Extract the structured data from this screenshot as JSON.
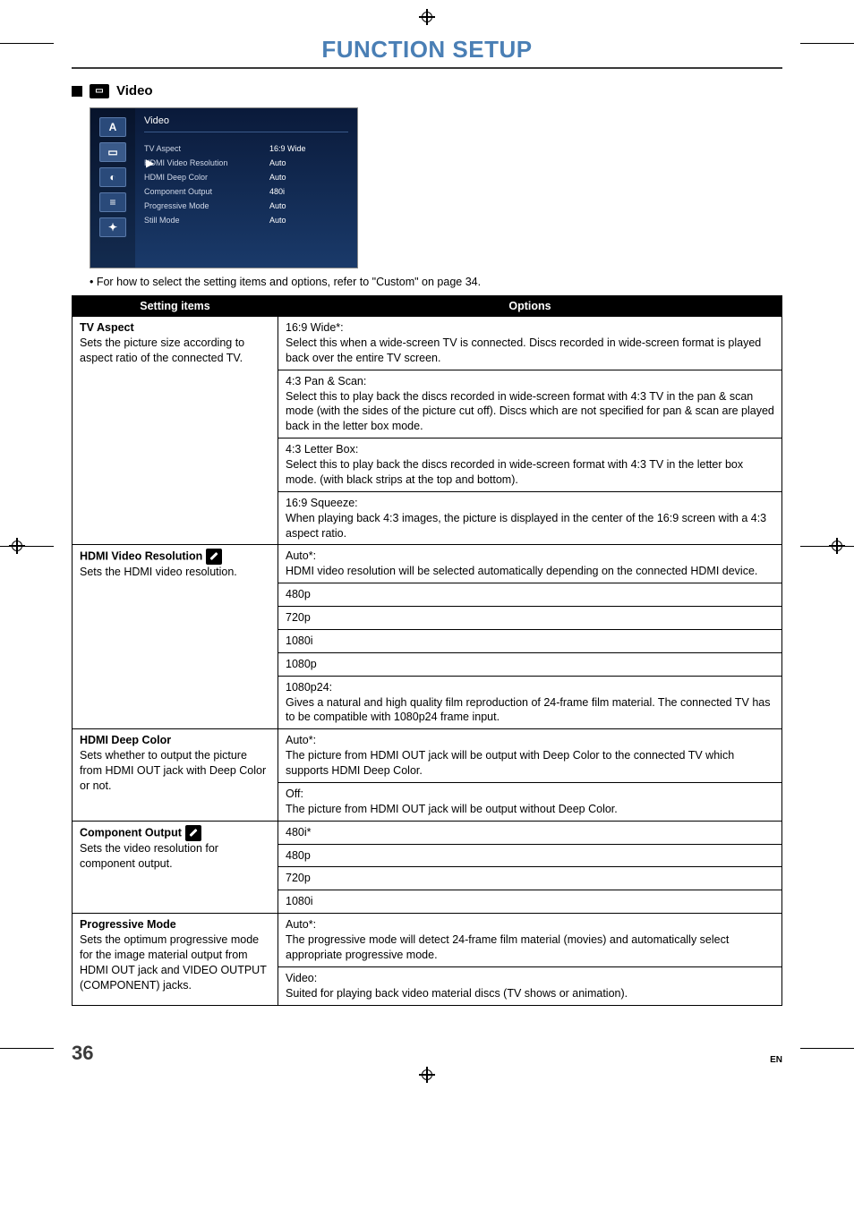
{
  "page_title": "FUNCTION SETUP",
  "section_label": "Video",
  "osd": {
    "title": "Video",
    "side_letter": "A",
    "rows": [
      {
        "k": "TV Aspect",
        "v": "16:9 Wide"
      },
      {
        "k": "HDMI Video Resolution",
        "v": "Auto"
      },
      {
        "k": "HDMI Deep Color",
        "v": "Auto"
      },
      {
        "k": "Component Output",
        "v": "480i"
      },
      {
        "k": "Progressive Mode",
        "v": "Auto"
      },
      {
        "k": "Still Mode",
        "v": "Auto"
      }
    ]
  },
  "note_bullet": "• For how to select the setting items and options, refer to \"Custom\" on page 34.",
  "headers": {
    "left": "Setting items",
    "right": "Options"
  },
  "items": [
    {
      "title": "TV Aspect",
      "desc": "Sets the picture size according to aspect ratio of the connected TV.",
      "tool": false,
      "options": [
        "16:9 Wide*:\nSelect this when a wide-screen TV is connected. Discs recorded in wide-screen format is played back over the entire TV screen.",
        "4:3 Pan & Scan:\nSelect this to play back the discs recorded in wide-screen format with 4:3 TV in the pan & scan mode (with the sides of the picture cut off). Discs which are not specified for pan & scan are played back in the letter box mode.",
        "4:3 Letter Box:\nSelect this to play back the discs recorded in wide-screen format with 4:3 TV in the letter box mode. (with black strips at the top and bottom).",
        "16:9 Squeeze:\nWhen playing back 4:3 images, the picture is displayed in the center of the 16:9 screen with a 4:3 aspect ratio."
      ]
    },
    {
      "title": "HDMI Video Resolution",
      "desc": "Sets the HDMI video resolution.",
      "tool": true,
      "options": [
        "Auto*:\nHDMI video resolution will be selected automatically depending on the connected HDMI device.",
        "480p",
        "720p",
        "1080i",
        "1080p",
        "1080p24:\nGives a natural and high quality film reproduction of 24-frame film material. The connected TV has to be compatible with 1080p24 frame input."
      ]
    },
    {
      "title": "HDMI Deep Color",
      "desc": "Sets whether to output the picture from HDMI OUT jack with Deep Color or not.",
      "tool": false,
      "options": [
        "Auto*:\nThe picture from HDMI OUT jack will be output with Deep Color to the connected TV which supports HDMI Deep Color.",
        "Off:\nThe picture from HDMI OUT jack will be output without Deep Color."
      ]
    },
    {
      "title": "Component Output",
      "desc": "Sets the video resolution for component output.",
      "tool": true,
      "options": [
        "480i*",
        "480p",
        "720p",
        "1080i"
      ]
    },
    {
      "title": "Progressive Mode",
      "desc": "Sets the optimum progressive mode for the image material output from HDMI OUT jack and VIDEO OUTPUT (COMPONENT) jacks.",
      "tool": false,
      "options": [
        "Auto*:\nThe progressive mode will detect 24-frame film material (movies) and automatically select appropriate progressive mode.",
        "Video:\nSuited for playing back video material discs (TV shows or animation)."
      ]
    }
  ],
  "footer": {
    "page": "36",
    "lang": "EN"
  }
}
